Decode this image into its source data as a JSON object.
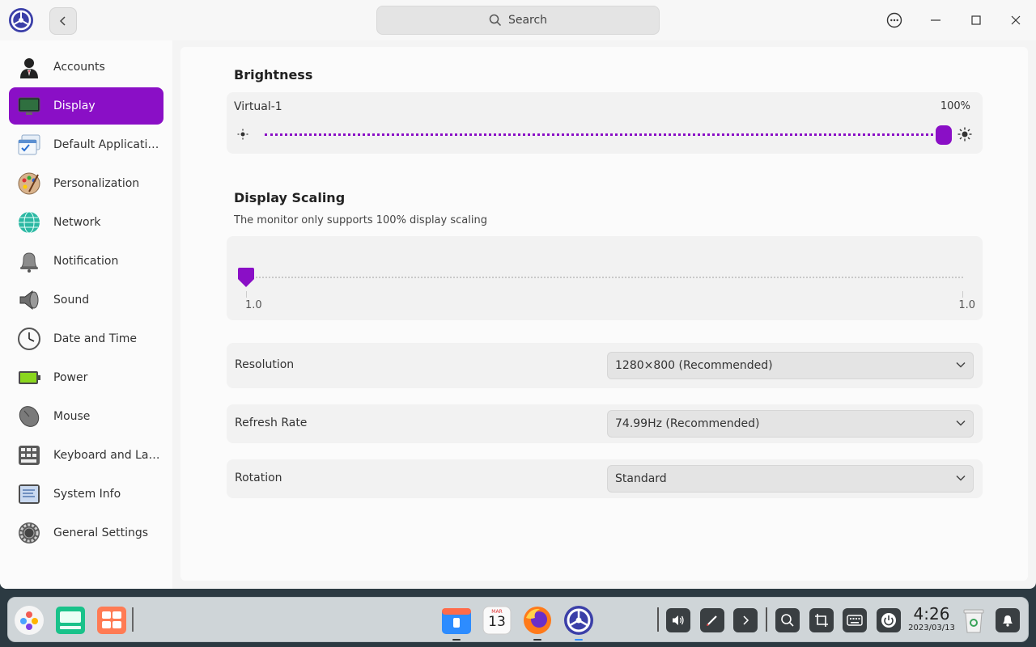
{
  "titlebar": {
    "search_placeholder": "Search"
  },
  "sidebar": {
    "items": [
      {
        "label": "Accounts",
        "icon": "accounts-icon"
      },
      {
        "label": "Display",
        "icon": "display-icon",
        "active": true
      },
      {
        "label": "Default Applicatio...",
        "icon": "default-applications-icon"
      },
      {
        "label": "Personalization",
        "icon": "personalization-icon"
      },
      {
        "label": "Network",
        "icon": "network-icon"
      },
      {
        "label": "Notification",
        "icon": "notification-icon"
      },
      {
        "label": "Sound",
        "icon": "sound-icon"
      },
      {
        "label": "Date and Time",
        "icon": "clock-icon"
      },
      {
        "label": "Power",
        "icon": "battery-icon"
      },
      {
        "label": "Mouse",
        "icon": "mouse-icon"
      },
      {
        "label": "Keyboard and Lan...",
        "icon": "keyboard-icon"
      },
      {
        "label": "System Info",
        "icon": "system-info-icon"
      },
      {
        "label": "General Settings",
        "icon": "general-settings-icon"
      }
    ]
  },
  "brightness": {
    "title": "Brightness",
    "monitor": "Virtual-1",
    "value_label": "100%",
    "value": 1.0
  },
  "scaling": {
    "title": "Display Scaling",
    "note": "The monitor only supports 100% display scaling",
    "min_label": "1.0",
    "max_label": "1.0"
  },
  "resolution": {
    "label": "Resolution",
    "value": "1280×800 (Recommended)"
  },
  "refresh": {
    "label": "Refresh Rate",
    "value": "74.99Hz (Recommended)"
  },
  "rotation": {
    "label": "Rotation",
    "value": "Standard"
  },
  "dock": {
    "calendar_month": "MAR",
    "calendar_day": "13",
    "clock_time": "4:26",
    "clock_date": "2023/03/13"
  },
  "colors": {
    "accent": "#8a0fc6"
  }
}
